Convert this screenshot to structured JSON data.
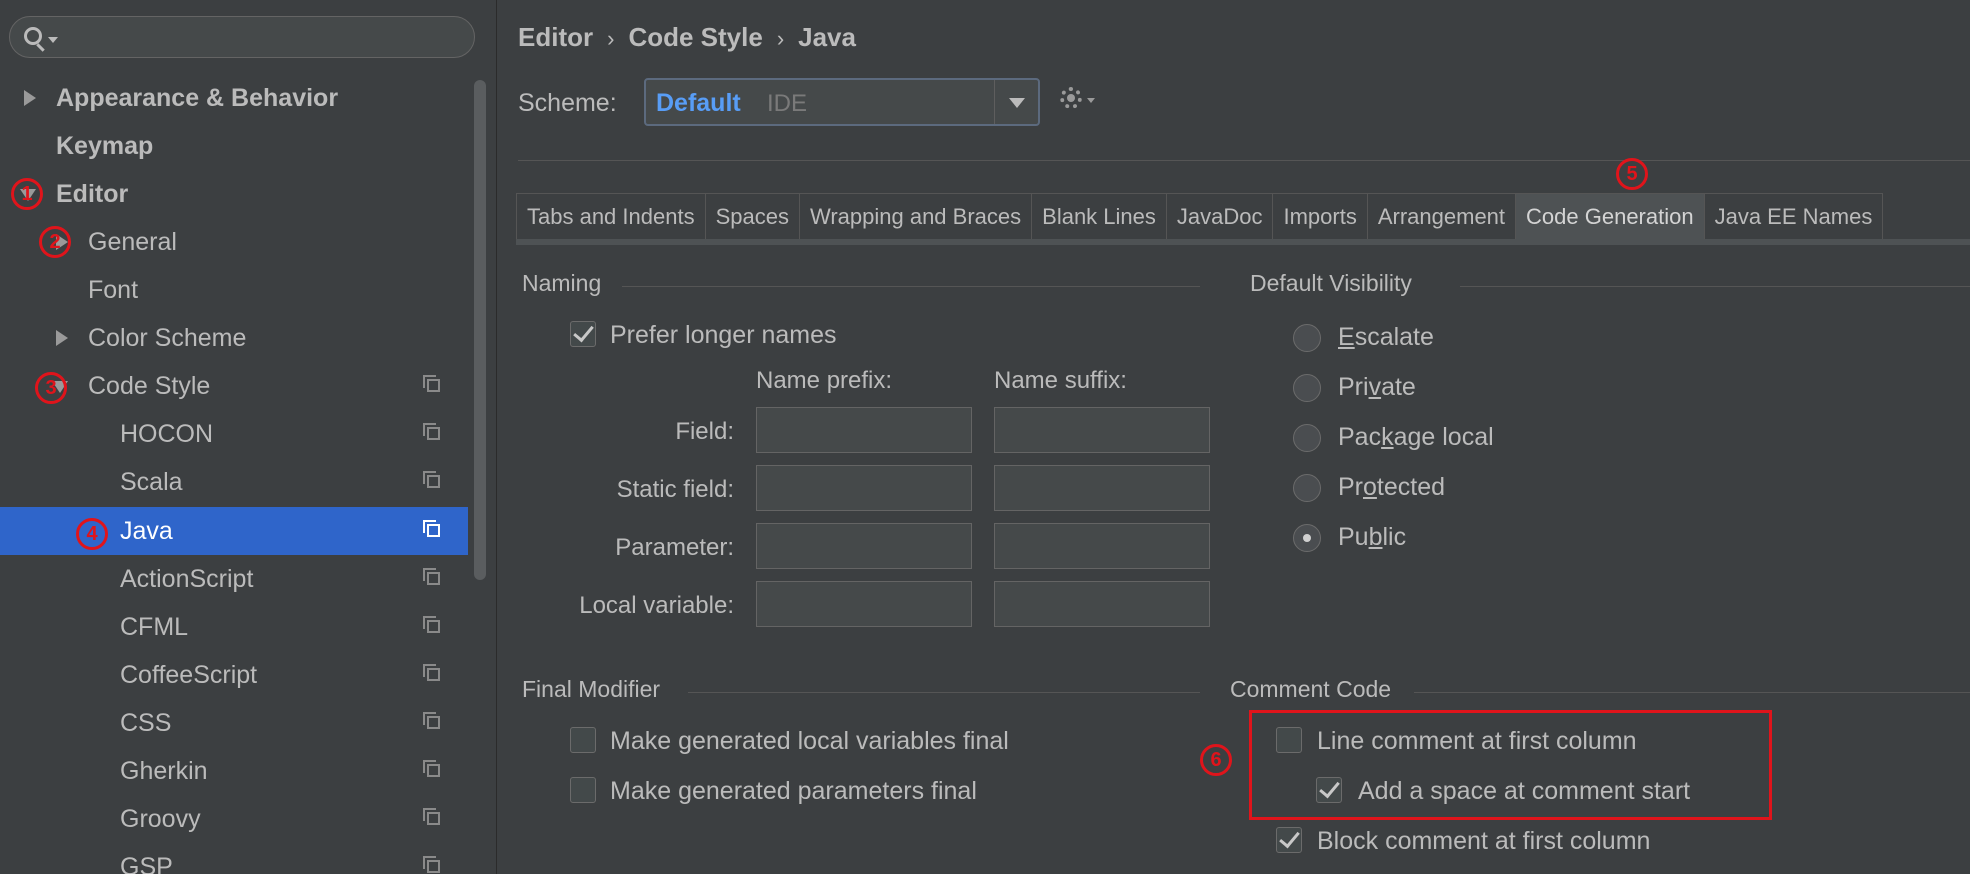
{
  "sidebar": {
    "search": {
      "placeholder": ""
    },
    "items": [
      {
        "label": "Appearance & Behavior"
      },
      {
        "label": "Keymap"
      },
      {
        "label": "Editor"
      },
      {
        "label": "General"
      },
      {
        "label": "Font"
      },
      {
        "label": "Color Scheme"
      },
      {
        "label": "Code Style"
      },
      {
        "label": "HOCON"
      },
      {
        "label": "Scala"
      },
      {
        "label": "Java"
      },
      {
        "label": "ActionScript"
      },
      {
        "label": "CFML"
      },
      {
        "label": "CoffeeScript"
      },
      {
        "label": "CSS"
      },
      {
        "label": "Gherkin"
      },
      {
        "label": "Groovy"
      },
      {
        "label": "GSP"
      }
    ],
    "markers": [
      "1",
      "2",
      "3",
      "4"
    ]
  },
  "breadcrumb": {
    "part1": "Editor",
    "part2": "Code Style",
    "part3": "Java",
    "sep": "›"
  },
  "scheme": {
    "label": "Scheme:",
    "name": "Default",
    "type": "IDE"
  },
  "tabs": [
    "Tabs and Indents",
    "Spaces",
    "Wrapping and Braces",
    "Blank Lines",
    "JavaDoc",
    "Imports",
    "Arrangement",
    "Code Generation",
    "Java EE Names"
  ],
  "active_tab": "Code Generation",
  "tab_marker": "5",
  "naming": {
    "title": "Naming",
    "prefer_longer": "Prefer longer names",
    "prefix_header": "Name prefix:",
    "suffix_header": "Name suffix:",
    "rows": [
      "Field:",
      "Static field:",
      "Parameter:",
      "Local variable:"
    ]
  },
  "visibility": {
    "title": "Default Visibility",
    "options": [
      {
        "pre": "",
        "u": "E",
        "post": "scalate"
      },
      {
        "pre": "Pri",
        "u": "v",
        "post": "ate"
      },
      {
        "pre": "Pac",
        "u": "k",
        "post": "age local"
      },
      {
        "pre": "Pr",
        "u": "o",
        "post": "tected"
      },
      {
        "pre": "Pu",
        "u": "b",
        "post": "lic"
      }
    ],
    "selected": "Public"
  },
  "final_modifier": {
    "title": "Final Modifier",
    "local_vars": "Make generated local variables final",
    "params": "Make generated parameters final"
  },
  "comment_code": {
    "title": "Comment Code",
    "marker": "6",
    "line_comment": "Line comment at first column",
    "add_space": "Add a space at comment start",
    "block_comment": "Block comment at first column"
  },
  "colors": {
    "accent": "#589df6",
    "selection": "#2f65ca",
    "annotation": "#e0141b"
  }
}
